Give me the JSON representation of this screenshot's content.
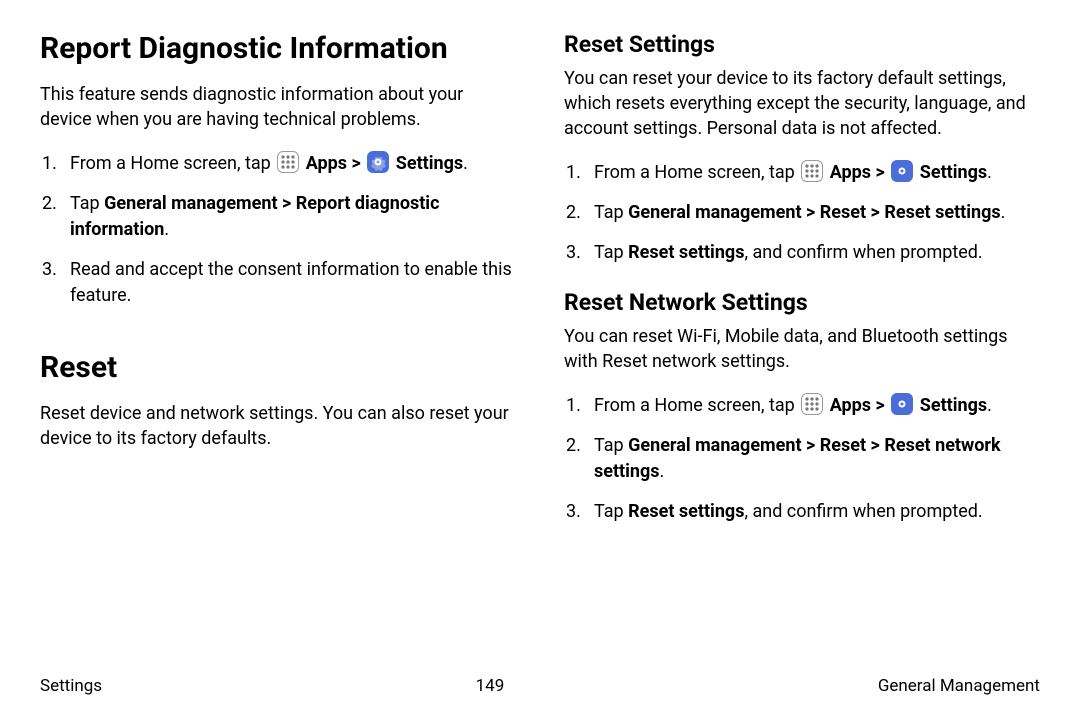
{
  "left": {
    "h1a": "Report Diagnostic Information",
    "p1": "This feature sends diagnostic information about your device when you are having technical problems.",
    "steps1": {
      "s1a": "From a Home screen, tap ",
      "s1_apps": "Apps",
      "s1_sep": " > ",
      "s1_settings": "Settings",
      "s1b": ".",
      "s2a": "Tap ",
      "s2b": "General management > Report diagnostic information",
      "s2c": ".",
      "s3": "Read and accept the consent information to enable this feature."
    },
    "h1b": "Reset",
    "p2": "Reset device and network settings. You can also reset your device to its factory defaults."
  },
  "right": {
    "h2a": "Reset Settings",
    "p1": "You can reset your device to its factory default settings, which resets everything except the security, language, and account settings. Personal data is not affected.",
    "stepsA": {
      "s1a": "From a Home screen, tap ",
      "s1_apps": "Apps",
      "s1_sep": " > ",
      "s1_settings": "Settings",
      "s1b": ".",
      "s2a": "Tap ",
      "s2b": "General management > Reset > Reset settings",
      "s2c": ".",
      "s3a": "Tap ",
      "s3b": "Reset settings",
      "s3c": ", and confirm when prompted."
    },
    "h2b": "Reset Network Settings",
    "p2": "You can reset Wi-Fi, Mobile data, and Bluetooth settings with Reset network settings.",
    "stepsB": {
      "s1a": "From a Home screen, tap ",
      "s1_apps": "Apps",
      "s1_sep": " > ",
      "s1_settings": "Settings",
      "s1b": ".",
      "s2a": "Tap ",
      "s2b": "General management > Reset > Reset network settings",
      "s2c": ".",
      "s3a": "Tap ",
      "s3b": "Reset settings",
      "s3c": ", and confirm when prompted."
    }
  },
  "footer": {
    "left": "Settings",
    "center": "149",
    "right": "General Management"
  }
}
